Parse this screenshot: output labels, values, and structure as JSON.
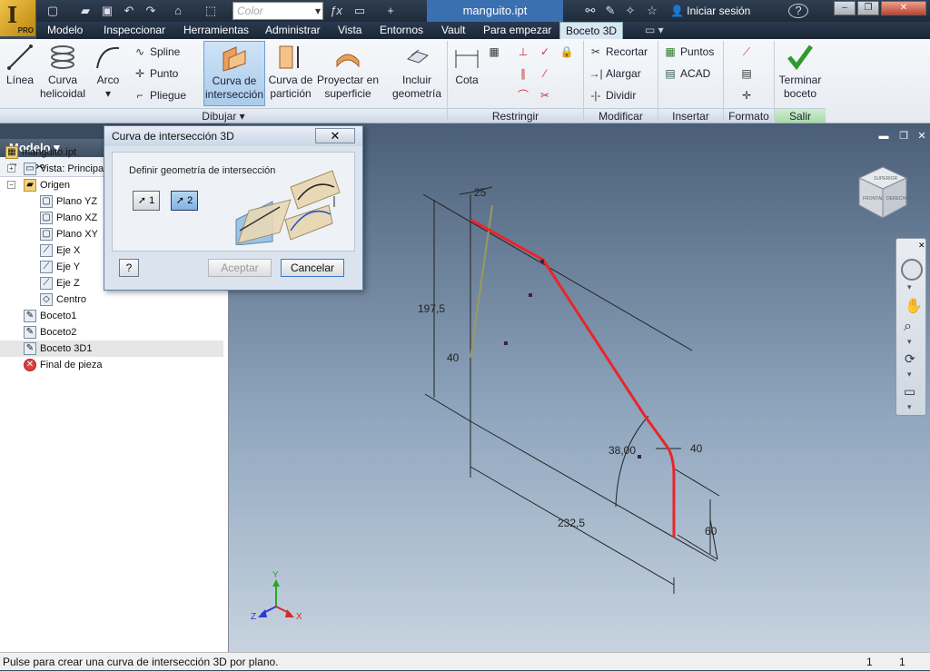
{
  "titlebar": {
    "app_badge": "PRO",
    "color_placeholder": "Color",
    "document_title": "manguito.ipt",
    "sign_in": "Iniciar sesión",
    "help_glyph": "?"
  },
  "menu": {
    "tabs": [
      "Modelo",
      "Inspeccionar",
      "Herramientas",
      "Administrar",
      "Vista",
      "Entornos",
      "Vault",
      "Para empezar",
      "Boceto 3D"
    ],
    "active_tab": "Boceto 3D"
  },
  "ribbon": {
    "dibujar": {
      "label": "Dibujar",
      "linea": "Línea",
      "curva_helicoidal": [
        "Curva",
        "helicoidal"
      ],
      "arco": "Arco",
      "spline": "Spline",
      "punto": "Punto",
      "pliegue": "Pliegue",
      "curva_interseccion": [
        "Curva de",
        "intersección"
      ],
      "curva_particion": [
        "Curva de",
        "partición"
      ],
      "proyectar": [
        "Proyectar en",
        "superficie"
      ],
      "incluir": [
        "Incluir",
        "geometría"
      ]
    },
    "restringir": {
      "label": "Restringir",
      "cota": "Cota"
    },
    "modificar": {
      "label": "Modificar",
      "recortar": "Recortar",
      "alargar": "Alargar",
      "dividir": "Dividir"
    },
    "insertar": {
      "label": "Insertar",
      "puntos": "Puntos",
      "acad": "ACAD"
    },
    "formato": {
      "label": "Formato"
    },
    "salir": {
      "label": "Salir",
      "terminar": [
        "Terminar",
        "boceto"
      ]
    }
  },
  "browser": {
    "title": "Modelo",
    "items": [
      {
        "label": "manguito.ipt",
        "indent": 0,
        "icon": "part-icon"
      },
      {
        "label": "Vista: Principal",
        "indent": 1,
        "icon": "view-icon"
      },
      {
        "label": "Origen",
        "indent": 1,
        "icon": "folder-icon"
      },
      {
        "label": "Plano YZ",
        "indent": 2,
        "icon": "plane-icon"
      },
      {
        "label": "Plano XZ",
        "indent": 2,
        "icon": "plane-icon"
      },
      {
        "label": "Plano XY",
        "indent": 2,
        "icon": "plane-icon"
      },
      {
        "label": "Eje X",
        "indent": 2,
        "icon": "axis-icon"
      },
      {
        "label": "Eje Y",
        "indent": 2,
        "icon": "axis-icon"
      },
      {
        "label": "Eje Z",
        "indent": 2,
        "icon": "axis-icon"
      },
      {
        "label": "Centro",
        "indent": 2,
        "icon": "point-icon"
      },
      {
        "label": "Boceto1",
        "indent": 1,
        "icon": "sketch-icon"
      },
      {
        "label": "Boceto2",
        "indent": 1,
        "icon": "sketch-icon"
      },
      {
        "label": "Boceto 3D1",
        "indent": 1,
        "icon": "sketch3d-icon"
      },
      {
        "label": "Final de pieza",
        "indent": 1,
        "icon": "end-of-part-icon"
      }
    ]
  },
  "dialog": {
    "title": "Curva de intersección 3D",
    "group_label": "Definir geometría de intersección",
    "select1": "1",
    "select2": "2",
    "accept": "Aceptar",
    "cancel": "Cancelar"
  },
  "viewport": {
    "dimensions": [
      "25",
      "197,5",
      "40",
      "38,00",
      "40",
      "232,5",
      "60"
    ],
    "triad": {
      "x": "X",
      "y": "Y",
      "z": "Z"
    },
    "viewcube_faces": [
      "SUPERIOR",
      "FRONTAL",
      "DERECHA"
    ]
  },
  "status": {
    "message": "Pulse para crear una curva de intersección 3D por plano.",
    "count_a": "1",
    "count_b": "1"
  },
  "colors": {
    "curve": "#e8262a",
    "accent": "#3a6fb0",
    "ok_green": "#2e9a2e"
  }
}
